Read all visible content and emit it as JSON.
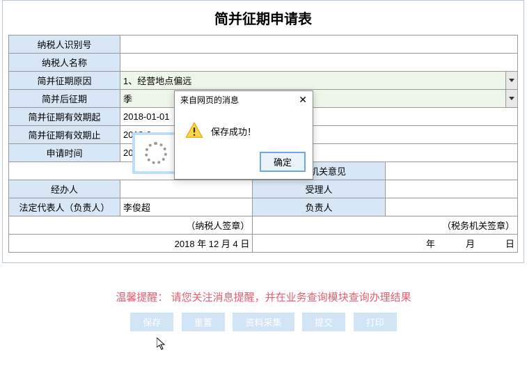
{
  "title": "简并征期申请表",
  "form": {
    "nsr_id": {
      "label": "纳税人识别号",
      "value": ""
    },
    "nsr_name": {
      "label": "纳税人名称",
      "value": ""
    },
    "reason": {
      "label": "简并征期原因",
      "value": "1、经营地点偏远"
    },
    "after_period": {
      "label": "简并后征期",
      "value": "季"
    },
    "valid_from": {
      "label": "简并征期有效期起",
      "value": "2018-01-01"
    },
    "valid_to": {
      "label": "简并征期有效期止",
      "value": "2018-0"
    },
    "apply_time": {
      "label": "申请时间",
      "value": "2018-1"
    }
  },
  "mid": {
    "tax_opinion": "税务机关意见",
    "jbr_label": "经办人",
    "jbr_value": "",
    "slr_label": "受理人",
    "slr_value": ""
  },
  "legal": {
    "rep_label": "法定代表人（负责人）",
    "rep_value": "李俊超",
    "fzr_label": "负责人",
    "fzr_value": ""
  },
  "sig": {
    "payer_stamp": "（纳税人签章）",
    "tax_stamp": "（税务机关签章）",
    "date_left": "2018 年 12 月 4 日",
    "date_right_y": "年",
    "date_right_m": "月",
    "date_right_d": "日"
  },
  "hint": {
    "tag": "温馨提醒：",
    "text": "请您关注消息提醒，并在业务查询模块查询办理结果"
  },
  "buttons": {
    "save": "保存",
    "reset": "重置",
    "collect": "资料采集",
    "submit": "提交",
    "print": "打印"
  },
  "dialog": {
    "title": "来自网页的消息",
    "message": "保存成功！",
    "ok": "确定"
  }
}
